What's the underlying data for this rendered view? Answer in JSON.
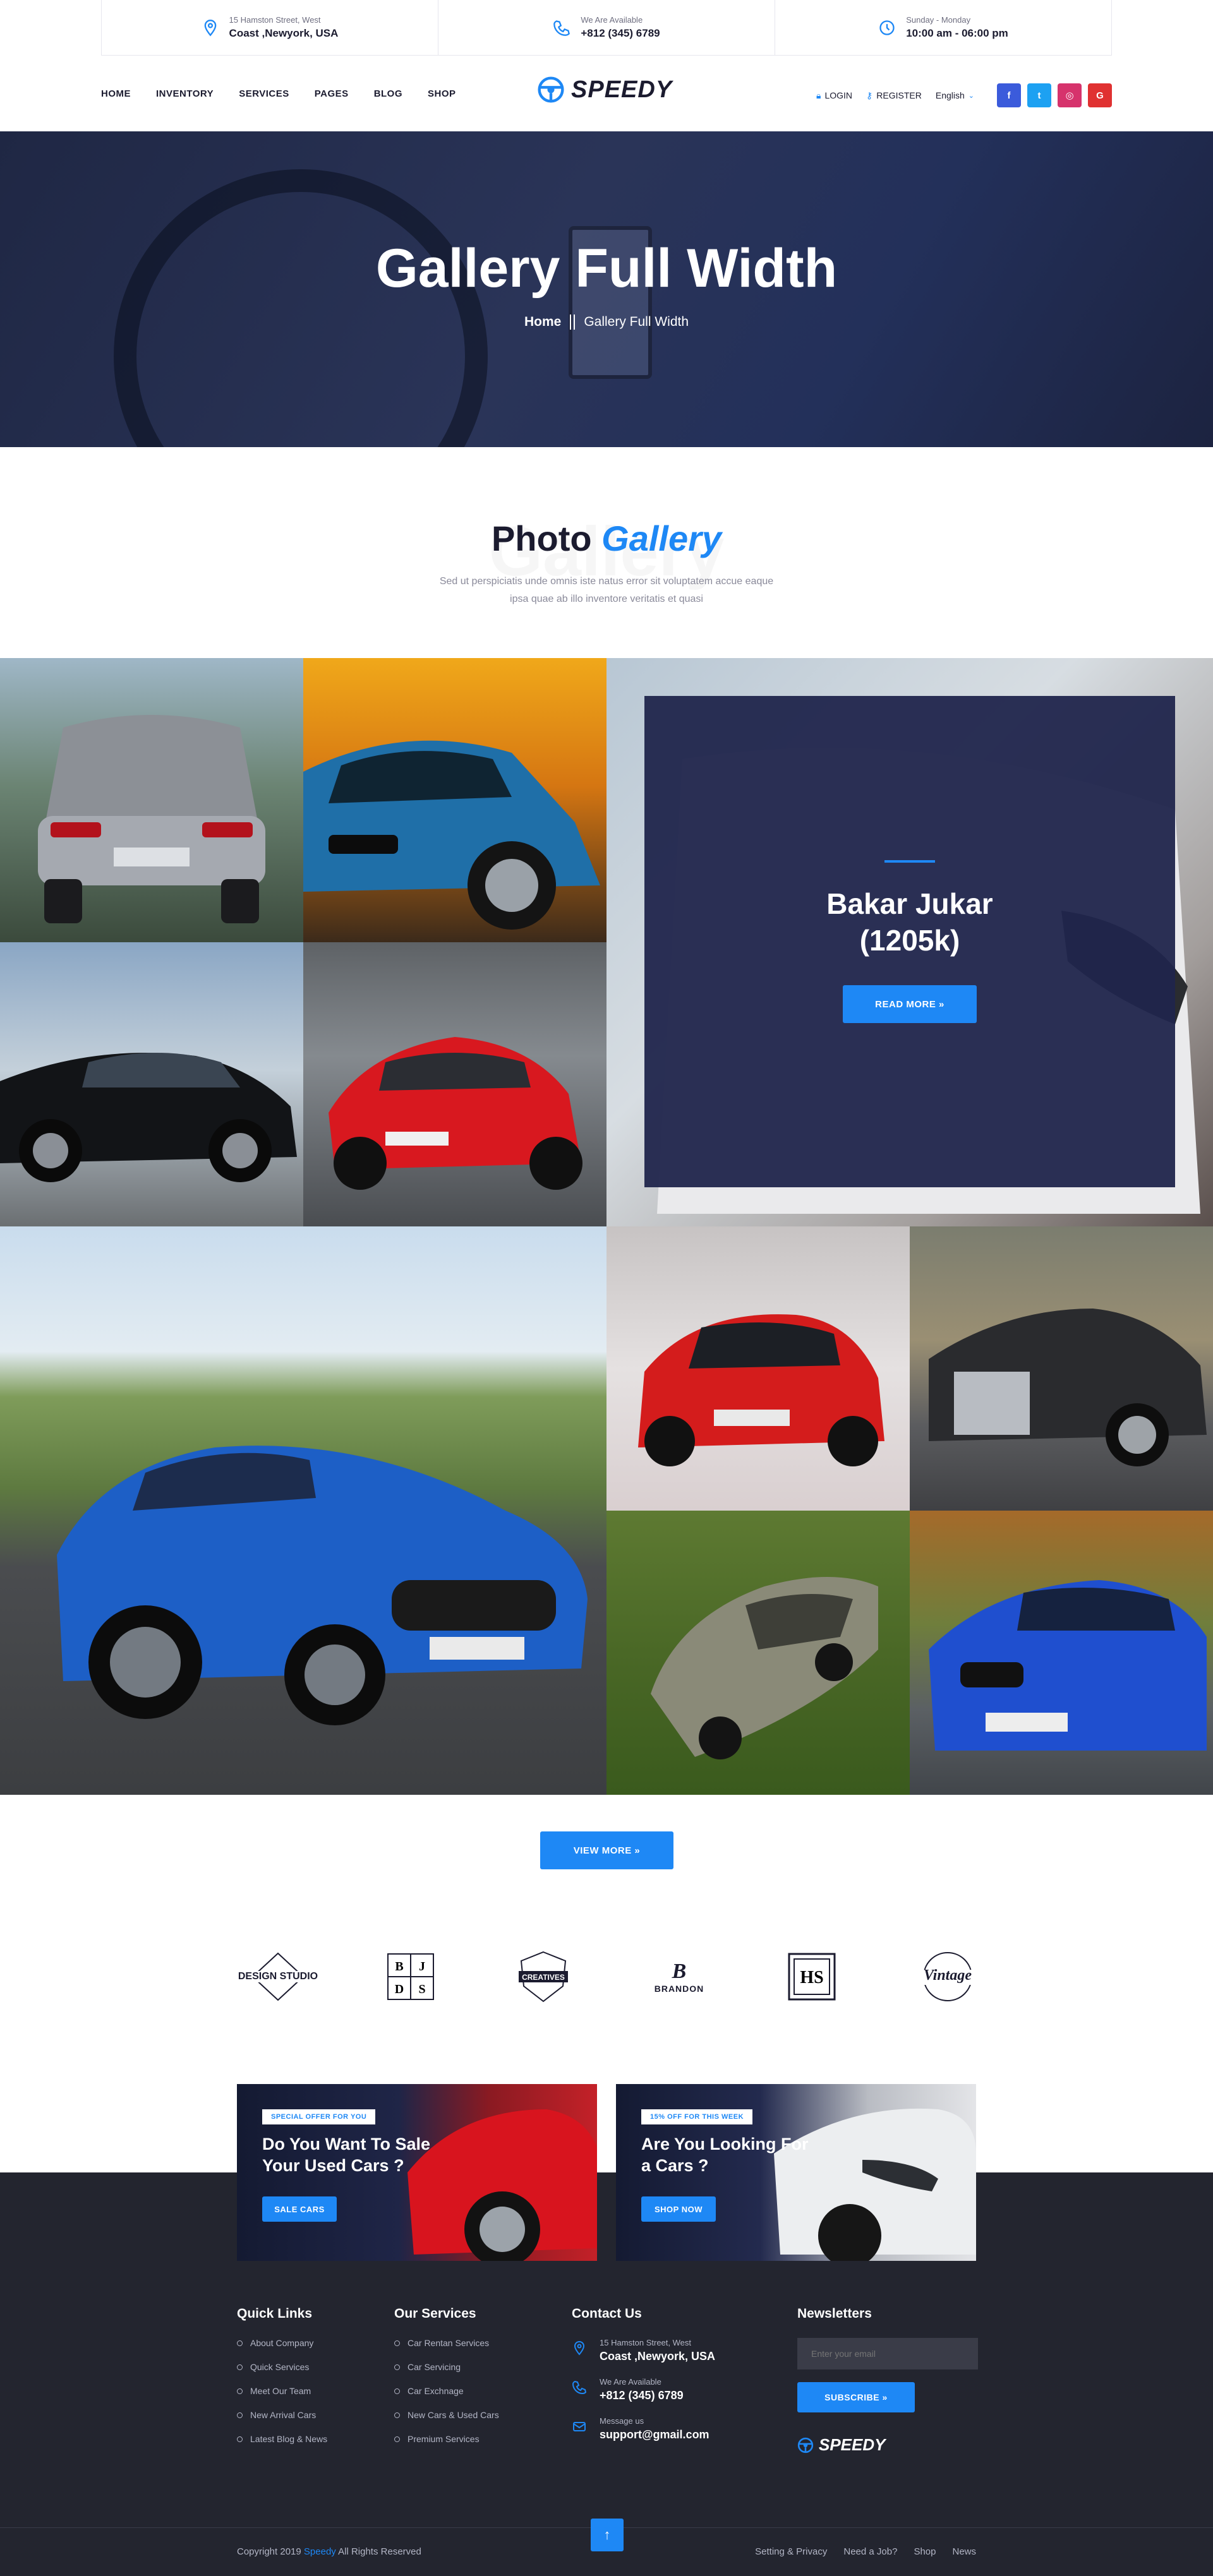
{
  "topbar": {
    "address": {
      "small": "15 Hamston Street, West",
      "big": "Coast ,Newyork, USA"
    },
    "phone": {
      "small": "We Are Available",
      "big": "+812 (345) 6789"
    },
    "hours": {
      "small": "Sunday - Monday",
      "big": "10:00 am - 06:00 pm"
    }
  },
  "nav": {
    "menu": [
      "HOME",
      "INVENTORY",
      "SERVICES",
      "PAGES",
      "BLOG",
      "SHOP"
    ],
    "logo": "SPEEDY",
    "login": "LOGIN",
    "register": "REGISTER",
    "language": "English",
    "social": [
      {
        "icon": "facebook-icon",
        "glyph": "f",
        "color": "#3b5bdb"
      },
      {
        "icon": "twitter-icon",
        "glyph": "t",
        "color": "#1da1f2"
      },
      {
        "icon": "instagram-icon",
        "glyph": "◎",
        "color": "#d6336c"
      },
      {
        "icon": "google-icon",
        "glyph": "G",
        "color": "#e03131"
      }
    ]
  },
  "hero": {
    "title": "Gallery Full Width",
    "breadcrumb_home": "Home",
    "breadcrumb_current": "Gallery Full Width"
  },
  "section": {
    "title_plain": "Photo",
    "title_accent": "Gallery",
    "ghost": "Gallery",
    "description": "Sed ut perspiciatis unde omnis iste natus error sit voluptatem accue eaque ipsa quae ab illo inventore veritatis et quasi"
  },
  "feature": {
    "name_line1": "Bakar Jukar",
    "name_line2": "(1205k)",
    "button": "READ MORE »"
  },
  "view_more": "VIEW MORE »",
  "brands": [
    "DESIGN STUDIO",
    "BJDS",
    "CREATIVES",
    "BRANDON",
    "HS",
    "Vintage"
  ],
  "promos": [
    {
      "tag": "SPECIAL OFFER FOR YOU",
      "title": "Do You Want To Sale Your Used Cars ?",
      "button": "SALE CARS"
    },
    {
      "tag": "15% OFF FOR THIS WEEK",
      "title": "Are You Looking For a Cars ?",
      "button": "SHOP NOW"
    }
  ],
  "footer": {
    "quick_links": {
      "title": "Quick Links",
      "items": [
        "About Company",
        "Quick Services",
        "Meet Our Team",
        "New Arrival Cars",
        "Latest Blog & News"
      ]
    },
    "services": {
      "title": "Our Services",
      "items": [
        "Car Rentan Services",
        "Car Servicing",
        "Car Exchnage",
        "New Cars & Used Cars",
        "Premium Services"
      ]
    },
    "contact": {
      "title": "Contact Us",
      "address_small": "15 Hamston Street, West",
      "address_big": "Coast ,Newyork, USA",
      "phone_small": "We Are Available",
      "phone_big": "+812 (345) 6789",
      "email_small": "Message us",
      "email_big": "support@gmail.com"
    },
    "newsletter": {
      "title": "Newsletters",
      "placeholder": "Enter your email",
      "button": "SUBSCRIBE »",
      "logo": "SPEEDY"
    },
    "copyright_prefix": "Copyright  2019",
    "copyright_brand": "Speedy",
    "copyright_suffix": "All Rights Reserved",
    "links": [
      "Setting & Privacy",
      "Need a Job?",
      "Shop",
      "News"
    ],
    "to_top": "↑"
  }
}
